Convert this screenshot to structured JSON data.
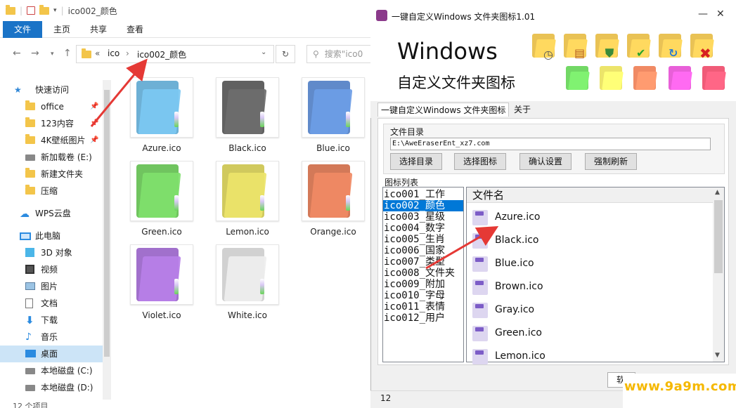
{
  "explorer": {
    "qat_path": "ico002_颜色",
    "ribbon_tabs": [
      "文件",
      "主页",
      "共享",
      "查看"
    ],
    "breadcrumb": [
      "ico",
      "ico002_颜色"
    ],
    "breadcrumb_prefix": "«",
    "search_placeholder": "搜索\"ico0",
    "sidebar": [
      {
        "label": "快速访问",
        "icon": "star-icon"
      },
      {
        "label": "office",
        "icon": "folder-icon",
        "pinned": true
      },
      {
        "label": "123内容",
        "icon": "folder-icon",
        "pinned": true
      },
      {
        "label": "4K壁纸图片",
        "icon": "folder-icon",
        "pinned": true
      },
      {
        "label": "新加载卷 (E:)",
        "icon": "drive-icon"
      },
      {
        "label": "新建文件夹",
        "icon": "folder-icon"
      },
      {
        "label": "压缩",
        "icon": "folder-icon"
      },
      {
        "label": "WPS云盘",
        "icon": "cloud-icon"
      },
      {
        "label": "此电脑",
        "icon": "computer-icon"
      },
      {
        "label": "3D 对象",
        "icon": "cube-icon"
      },
      {
        "label": "视频",
        "icon": "video-icon"
      },
      {
        "label": "图片",
        "icon": "picture-icon"
      },
      {
        "label": "文档",
        "icon": "document-icon"
      },
      {
        "label": "下载",
        "icon": "download-icon"
      },
      {
        "label": "音乐",
        "icon": "music-icon"
      },
      {
        "label": "桌面",
        "icon": "desktop-icon",
        "selected": true
      },
      {
        "label": "本地磁盘 (C:)",
        "icon": "drive-icon"
      },
      {
        "label": "本地磁盘 (D:)",
        "icon": "drive-icon"
      }
    ],
    "files": [
      {
        "name": "Azure.ico",
        "color": "#7cc8f2"
      },
      {
        "name": "Black.ico",
        "color": "#6e6e6e"
      },
      {
        "name": "Blue.ico",
        "color": "#6d9de6"
      },
      {
        "name": "Green.ico",
        "color": "#7fdf6c"
      },
      {
        "name": "Lemon.ico",
        "color": "#ece46a"
      },
      {
        "name": "Orange.ico",
        "color": "#f08a64"
      },
      {
        "name": "Violet.ico",
        "color": "#b77fe8"
      },
      {
        "name": "White.ico",
        "color": "#eeeeee"
      }
    ],
    "status": "12 个项目"
  },
  "app": {
    "title": "一键自定义Windows 文件夹图标1.01",
    "hero_title": "Windows",
    "hero_subtitle": "自定义文件夹图标",
    "tabs": [
      "一键自定义Windows 文件夹图标",
      "关于"
    ],
    "dir_label": "文件目录",
    "dir_value": "E:\\AweEraserEnt_xz7.com",
    "buttons": [
      "选择目录",
      "选择图标",
      "确认设置",
      "强制刷新"
    ],
    "list_label": "图标列表",
    "icon_list": [
      "ico001_工作",
      "ico002_颜色",
      "ico003_星级",
      "ico004_数字",
      "ico005_生肖",
      "ico006_国家",
      "ico007_类型",
      "ico008_文件夹",
      "ico009_附加",
      "ico010_字母",
      "ico011_表情",
      "ico012_用户"
    ],
    "icon_list_selected": 1,
    "file_header": "文件名",
    "file_list": [
      "Azure.ico",
      "Black.ico",
      "Blue.ico",
      "Brown.ico",
      "Gray.ico",
      "Green.ico",
      "Lemon.ico"
    ],
    "bottom_button": "软",
    "status": "12"
  },
  "watermark": "www.9a9m.com",
  "colors": {
    "accent": "#1a73c7",
    "selection": "#0078d7",
    "arrow": "#e53935",
    "watermark": "#f5b800"
  }
}
